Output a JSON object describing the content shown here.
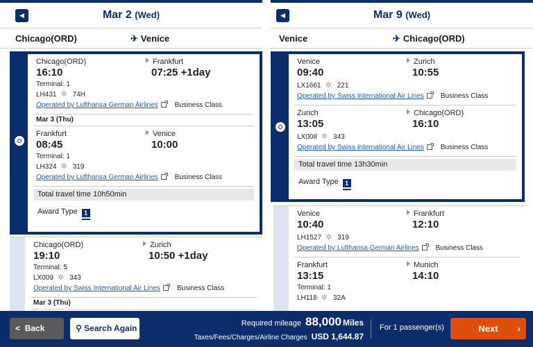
{
  "outbound": {
    "date": "Mar 2",
    "weekday": "(Wed)",
    "from": "Chicago(ORD)",
    "to": "Venice",
    "options": [
      {
        "selected": true,
        "segments": [
          {
            "dep_city": "Chicago(ORD)",
            "arr_city": "Frankfurt",
            "dep_time": "16:10",
            "arr_time": "07:25 +1day",
            "terminal": "Terminal: 1",
            "flight_no": "LH431",
            "aircraft": "74H",
            "operator": "Operated by Lufthansa German Airlines",
            "cabin": "Business Class"
          },
          {
            "date_header": "Mar 3 (Thu)",
            "dep_city": "Frankfurt",
            "arr_city": "Venice",
            "dep_time": "08:45",
            "arr_time": "10:00",
            "terminal": "Terminal: 1",
            "flight_no": "LH324",
            "aircraft": "319",
            "operator": "Operated by Lufthansa German Airlines",
            "cabin": "Business Class"
          }
        ],
        "total_time": "Total travel time 10h50min",
        "award_label": "Award Type",
        "award_value": "1"
      },
      {
        "selected": false,
        "segments": [
          {
            "dep_city": "Chicago(ORD)",
            "arr_city": "Zurich",
            "dep_time": "19:10",
            "arr_time": "10:50 +1day",
            "terminal": "Terminal: 5",
            "flight_no": "LX009",
            "aircraft": "343",
            "operator": "Operated by Swiss International Air Lines",
            "cabin": "Business Class"
          }
        ],
        "next_date_header": "Mar 3 (Thu)"
      }
    ]
  },
  "return": {
    "date": "Mar 9",
    "weekday": "(Wed)",
    "from": "Venice",
    "to": "Chicago(ORD)",
    "options": [
      {
        "selected": true,
        "segments": [
          {
            "dep_city": "Venice",
            "arr_city": "Zurich",
            "dep_time": "09:40",
            "arr_time": "10:55",
            "flight_no": "LX1661",
            "aircraft": "221",
            "operator": "Operated by Swiss International Air Lines",
            "cabin": "Business Class"
          },
          {
            "dep_city": "Zurich",
            "arr_city": "Chicago(ORD)",
            "dep_time": "13:05",
            "arr_time": "16:10",
            "flight_no": "LX008",
            "aircraft": "343",
            "operator": "Operated by Swiss International Air Lines",
            "cabin": "Business Class"
          }
        ],
        "total_time": "Total travel time 13h30min",
        "award_label": "Award Type",
        "award_value": "1"
      },
      {
        "selected": false,
        "segments": [
          {
            "dep_city": "Venice",
            "arr_city": "Frankfurt",
            "dep_time": "10:40",
            "arr_time": "12:10",
            "flight_no": "LH1527",
            "aircraft": "319",
            "operator": "Operated by Lufthansa German Airlines",
            "cabin": "Business Class"
          },
          {
            "dep_city": "Frankfurt",
            "arr_city": "Munich",
            "dep_time": "13:15",
            "arr_time": "14:10",
            "terminal": "Terminal: 1",
            "flight_no": "LH118",
            "aircraft": "32A"
          }
        ]
      }
    ]
  },
  "footer": {
    "back_label": "Back",
    "search_label": "Search Again",
    "mileage_label": "Required mileage",
    "mileage_value": "88,000",
    "mileage_unit": "Miles",
    "taxes_label": "Taxes/Fees/Charges/Airline Charges",
    "taxes_value": "USD 1,644.87",
    "passengers": "For 1 passenger(s)",
    "next_label": "Next"
  },
  "colors": {
    "navy": "#0b2d6b",
    "link": "#1d5bb8",
    "next": "#e04e0c"
  }
}
